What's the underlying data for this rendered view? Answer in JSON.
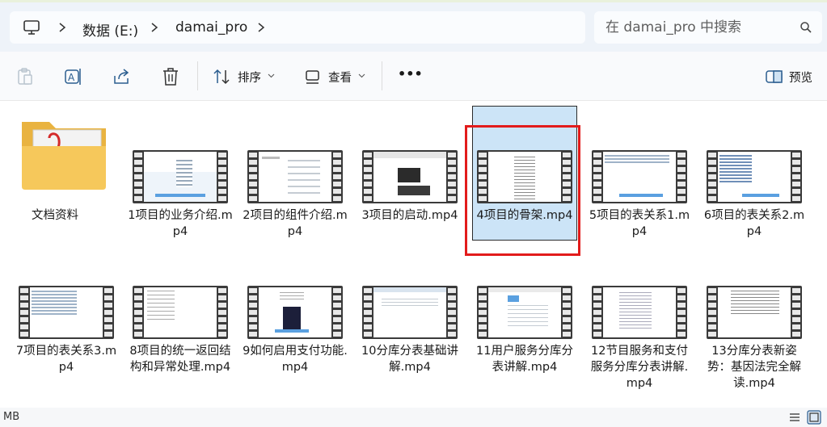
{
  "address": {
    "crumbs": [
      "数据 (E:)",
      "damai_pro"
    ],
    "search_placeholder": "在 damai_pro 中搜索"
  },
  "toolbar": {
    "sort_label": "排序",
    "view_label": "查看",
    "more_label": "•••",
    "preview_label": "预览"
  },
  "items": [
    {
      "label": "文档资料",
      "type": "folder"
    },
    {
      "label": "1项目的业务介绍.mp4",
      "type": "video"
    },
    {
      "label": "2项目的组件介绍.mp4",
      "type": "video"
    },
    {
      "label": "3项目的启动.mp4",
      "type": "video"
    },
    {
      "label": "4项目的骨架.mp4",
      "type": "video",
      "selected": true
    },
    {
      "label": "5项目的表关系1.mp4",
      "type": "video"
    },
    {
      "label": "6项目的表关系2.mp4",
      "type": "video"
    },
    {
      "label": "7项目的表关系3.mp4",
      "type": "video"
    },
    {
      "label": "8项目的统一返回结构和异常处理.mp4",
      "type": "video"
    },
    {
      "label": "9如何启用支付功能.mp4",
      "type": "video"
    },
    {
      "label": "10分库分表基础讲解.mp4",
      "type": "video"
    },
    {
      "label": "11用户服务分库分表讲解.mp4",
      "type": "video"
    },
    {
      "label": "12节目服务和支付服务分库分表讲解.mp4",
      "type": "video"
    },
    {
      "label": "13分库分表新姿势：基因法完全解读.mp4",
      "type": "video"
    }
  ],
  "status": {
    "text": "MB"
  },
  "colors": {
    "selection": "#cce4f7",
    "highlight": "#e21b1b",
    "folder": "#f6c85b"
  }
}
